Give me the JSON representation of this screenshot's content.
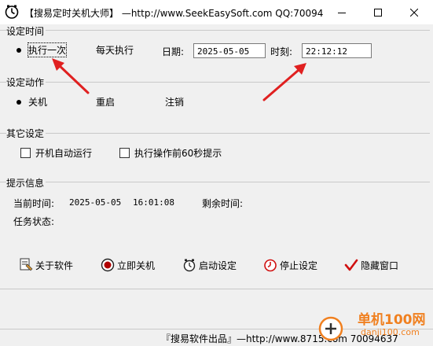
{
  "window": {
    "title": "【搜易定时关机大师】 —http://www.SeekEasySoft.com QQ:70094..."
  },
  "set_time": {
    "group_label": "设定时间",
    "once_label": "执行一次",
    "daily_label": "每天执行",
    "selected": "once",
    "date_label": "日期:",
    "date_value": "2025-05-05",
    "time_label": "时刻:",
    "time_value": "22:12:12"
  },
  "set_action": {
    "group_label": "设定动作",
    "options": [
      "关机",
      "重启",
      "注销"
    ],
    "selected": "关机"
  },
  "other": {
    "group_label": "其它设定",
    "autostart_label": "开机自动运行",
    "prompt_label": "执行操作前60秒提示"
  },
  "info": {
    "group_label": "提示信息",
    "current_time_label": "当前时间:",
    "current_date": "2025-05-05",
    "current_clock": "16:01:08",
    "remaining_label": "剩余时间:",
    "task_status_label": "任务状态:"
  },
  "toolbar": {
    "about_label": "关于软件",
    "shutdown_now_label": "立即关机",
    "start_label": "启动设定",
    "stop_label": "停止设定",
    "hide_label": "隐藏窗口"
  },
  "status_bar": {
    "text": "『搜易软件出品』—http://www.8715.com 70094637"
  },
  "watermark": {
    "text": "单机100网",
    "sub": "danji100.com"
  },
  "colors": {
    "arrow": "#e02020",
    "watermark": "#f08020",
    "stop_icon": "#d01010",
    "check_icon": "#d01010"
  }
}
